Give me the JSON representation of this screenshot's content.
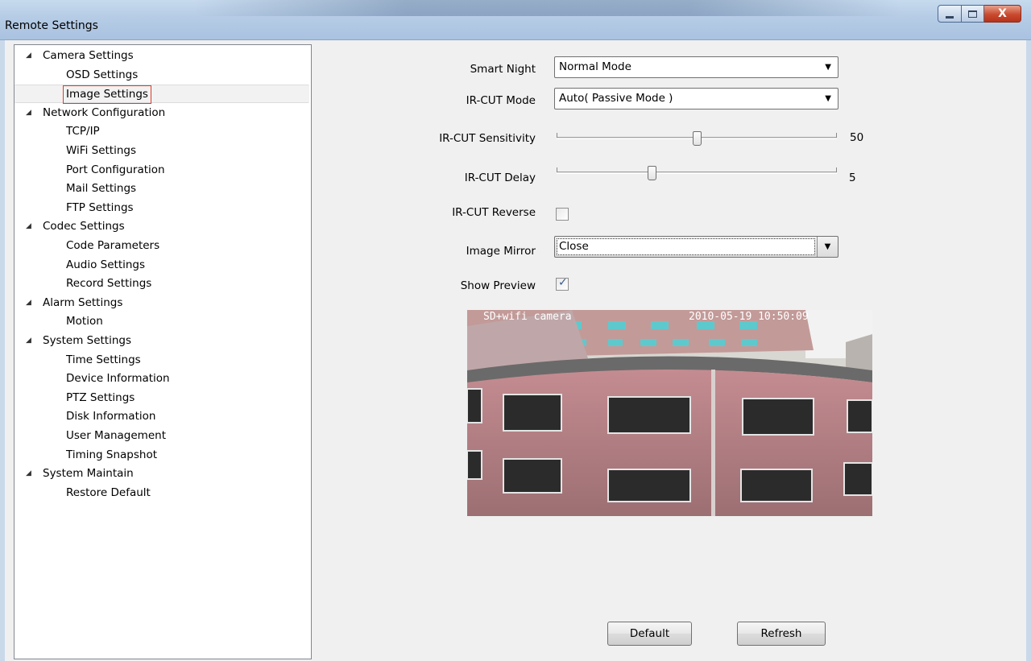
{
  "window": {
    "title": "Remote Settings",
    "close_glyph": "X"
  },
  "tree": {
    "groups": [
      {
        "label": "Camera Settings",
        "items": [
          "OSD Settings",
          "Image Settings"
        ]
      },
      {
        "label": "Network Configuration",
        "items": [
          "TCP/IP",
          "WiFi Settings",
          "Port Configuration",
          "Mail Settings",
          "FTP Settings"
        ]
      },
      {
        "label": "Codec Settings",
        "items": [
          "Code Parameters",
          "Audio Settings",
          "Record Settings"
        ]
      },
      {
        "label": "Alarm Settings",
        "items": [
          "Motion"
        ]
      },
      {
        "label": "System Settings",
        "items": [
          "Time Settings",
          "Device Information",
          "PTZ Settings",
          "Disk Information",
          "User Management",
          "Timing Snapshot"
        ]
      },
      {
        "label": "System Maintain",
        "items": [
          "Restore Default"
        ]
      }
    ],
    "selected": "Image Settings"
  },
  "form": {
    "smart_night": {
      "label": "Smart Night",
      "value": "Normal Mode"
    },
    "ircut_mode": {
      "label": "IR-CUT Mode",
      "value": "Auto( Passive Mode )"
    },
    "ircut_sensitivity": {
      "label": "IR-CUT Sensitivity",
      "value": "50",
      "level": 0.5
    },
    "ircut_delay": {
      "label": "IR-CUT Delay",
      "value": "5",
      "level": 0.34
    },
    "ircut_reverse": {
      "label": "IR-CUT Reverse",
      "checked": false
    },
    "image_mirror": {
      "label": "Image Mirror",
      "value": "Close"
    },
    "show_preview": {
      "label": "Show Preview",
      "checked": true
    }
  },
  "preview": {
    "osd_name": "SD+wifi camera",
    "osd_time": "2010-05-19 10:50:09"
  },
  "buttons": {
    "default": "Default",
    "refresh": "Refresh"
  },
  "icons": {
    "expand": "triangle-expanded-icon",
    "dropdown": "chevron-down-icon",
    "check": "checkmark-icon"
  }
}
